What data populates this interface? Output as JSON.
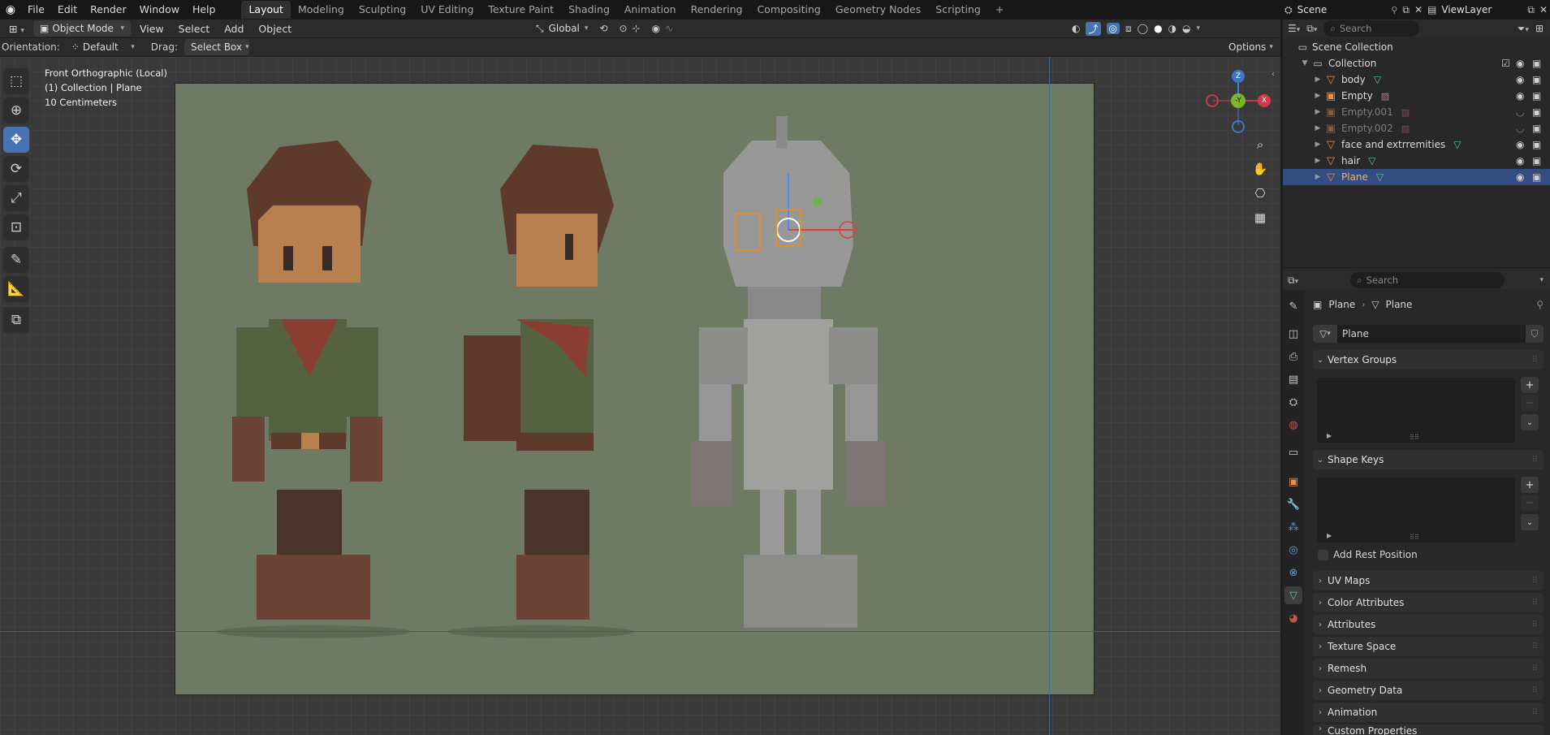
{
  "topbar": {
    "menus": [
      "File",
      "Edit",
      "Render",
      "Window",
      "Help"
    ],
    "workspaces": [
      "Layout",
      "Modeling",
      "Sculpting",
      "UV Editing",
      "Texture Paint",
      "Shading",
      "Animation",
      "Rendering",
      "Compositing",
      "Geometry Nodes",
      "Scripting"
    ],
    "active_workspace": "Layout",
    "add_tab": "+",
    "scene": "Scene",
    "view_layer": "ViewLayer"
  },
  "viewport_header": {
    "mode": "Object Mode",
    "menus": [
      "View",
      "Select",
      "Add",
      "Object"
    ],
    "transform_orientation": "Global"
  },
  "tool_settings": {
    "orientation_label": "Orientation:",
    "orientation_value": "Default",
    "drag_label": "Drag:",
    "drag_value": "Select Box",
    "options": "Options"
  },
  "viewport_overlay": {
    "view_name": "Front Orthographic (Local)",
    "collection_info": "(1) Collection | Plane",
    "grid_scale": "10 Centimeters"
  },
  "gizmo": {
    "z": "Z",
    "y": "-Y",
    "x": "X"
  },
  "outliner": {
    "search_placeholder": "Search",
    "root": "Scene Collection",
    "collection": "Collection",
    "items": [
      {
        "name": "body",
        "data": "mesh"
      },
      {
        "name": "Empty",
        "data": "image"
      },
      {
        "name": "Empty.001",
        "data": "image"
      },
      {
        "name": "Empty.002",
        "data": "image"
      },
      {
        "name": "face and extrremities",
        "data": "mesh"
      },
      {
        "name": "hair",
        "data": "mesh"
      },
      {
        "name": "Plane",
        "data": "mesh"
      }
    ],
    "selected": "Plane"
  },
  "properties": {
    "search_placeholder": "Search",
    "breadcrumb_object": "Plane",
    "breadcrumb_data": "Plane",
    "datablock_name": "Plane",
    "panels_open": [
      "Vertex Groups",
      "Shape Keys"
    ],
    "add_rest_position": "Add Rest Position",
    "panels_closed": [
      "UV Maps",
      "Color Attributes",
      "Attributes",
      "Texture Space",
      "Remesh",
      "Geometry Data",
      "Animation",
      "Custom Properties"
    ]
  },
  "colors": {
    "accent": "#4772b3",
    "selection": "#334d80",
    "object_orange": "#e3904a",
    "mesh_green": "#55c6a4"
  }
}
